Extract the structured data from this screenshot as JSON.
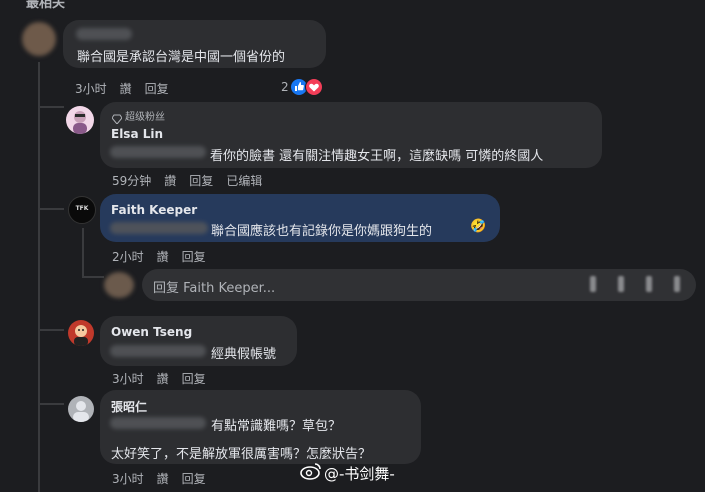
{
  "header": {
    "sort_label": "最相关"
  },
  "comments": [
    {
      "text": "聯合國是承認台灣是中國一個省份的",
      "time": "3小时",
      "like": "讚",
      "reply": "回复",
      "reaction_count": "2"
    },
    {
      "badge": "超级粉丝",
      "name": "Elsa Lin",
      "text": "看你的臉書 還有關注情趣女王啊，這麼缺嗎 可憐的終國人",
      "time": "59分钟",
      "like": "讚",
      "reply": "回复",
      "edited": "已编辑"
    },
    {
      "name": "Faith Keeper",
      "avatar_label": "TFK",
      "text": "聯合國應該也有記錄你是你媽跟狗生的",
      "emoji": "🤣",
      "time": "2小时",
      "like": "讚",
      "reply": "回复"
    },
    {
      "name": "Owen Tseng",
      "text": "經典假帳號",
      "time": "3小时",
      "like": "讚",
      "reply": "回复"
    },
    {
      "name": "張昭仁",
      "text_line1": "有點常識難嗎？草包？",
      "text_line2": "太好笑了，不是解放軍很厲害嗎？怎麼狀告？",
      "time": "3小时",
      "like": "讚",
      "reply": "回复"
    }
  ],
  "reply_input": {
    "placeholder": "回复 Faith Keeper..."
  },
  "watermark": {
    "text": "@-书剑舞-"
  },
  "colors": {
    "bg": "#1c1d20",
    "bubble": "#2d2e31",
    "highlight": "#263a5c",
    "like_blue": "#1877f2",
    "love_red": "#f33e58"
  }
}
